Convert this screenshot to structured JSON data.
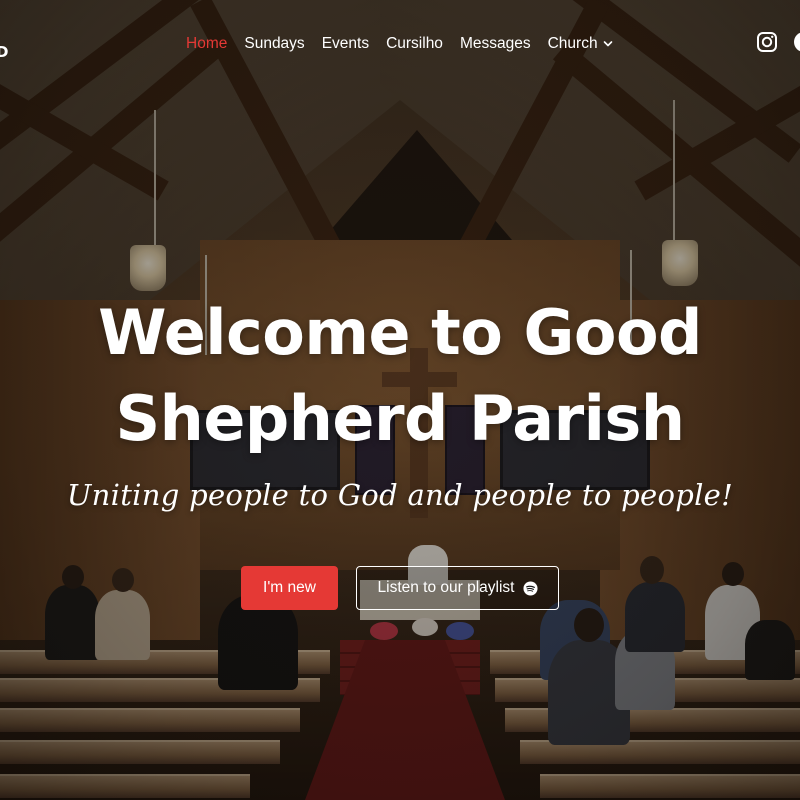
{
  "brand": {
    "logo_fragment": "D"
  },
  "nav": {
    "items": [
      {
        "label": "Home",
        "active": true
      },
      {
        "label": "Sundays",
        "active": false
      },
      {
        "label": "Events",
        "active": false
      },
      {
        "label": "Cursilho",
        "active": false
      },
      {
        "label": "Messages",
        "active": false
      },
      {
        "label": "Church",
        "active": false,
        "dropdown": true
      }
    ],
    "social_icons": [
      "instagram-icon",
      "facebook-icon"
    ]
  },
  "hero": {
    "title_line1": "Welcome to Good",
    "title_line2": "Shepherd Parish",
    "subtitle": "Uniting people to God and people to people!",
    "primary_button": "I'm new",
    "secondary_button": "Listen to our playlist",
    "secondary_button_icon": "spotify-icon"
  },
  "colors": {
    "accent": "#e53935",
    "text": "#ffffff"
  }
}
